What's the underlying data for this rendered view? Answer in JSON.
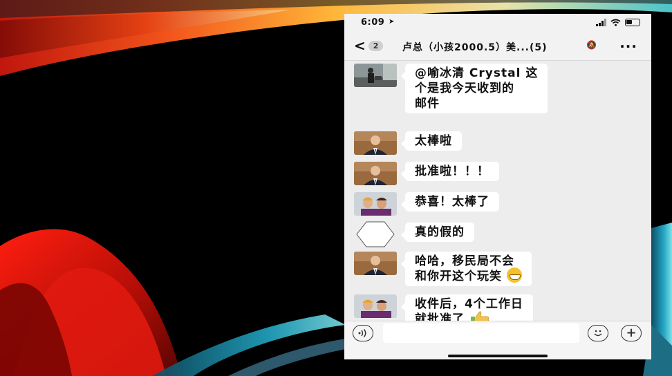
{
  "status_bar": {
    "time": "6:09"
  },
  "nav": {
    "unread_count": "2",
    "title": "卢总（小孩2000.5）美...(5)"
  },
  "messages": [
    {
      "lines": [
        "@喻冰清 Crystal 这",
        "个是我今天收到的",
        "邮件"
      ],
      "emoji": ""
    },
    {
      "lines": [
        "太棒啦"
      ],
      "emoji": ""
    },
    {
      "lines": [
        "批准啦！！！"
      ],
      "emoji": ""
    },
    {
      "lines": [
        "恭喜！太棒了"
      ],
      "emoji": ""
    },
    {
      "lines": [
        "真的假的"
      ],
      "emoji": ""
    },
    {
      "lines": [
        "哈哈，移民局不会",
        "和你开这个玩笑"
      ],
      "emoji": "grin-emoji"
    },
    {
      "lines": [
        "收件后，4个工作日",
        "就批准了"
      ],
      "emoji": "thumbs-up-emoji"
    }
  ],
  "icons": {
    "back": "chevron-left-icon",
    "mute": "bell-muted-icon",
    "more": "more-icon",
    "voice": "voice-icon",
    "emoji": "emoji-icon",
    "add": "plus-icon"
  },
  "colors": {
    "bubble": "#ffffff",
    "chat_background": "#ededed",
    "slide_background": "#000000"
  }
}
